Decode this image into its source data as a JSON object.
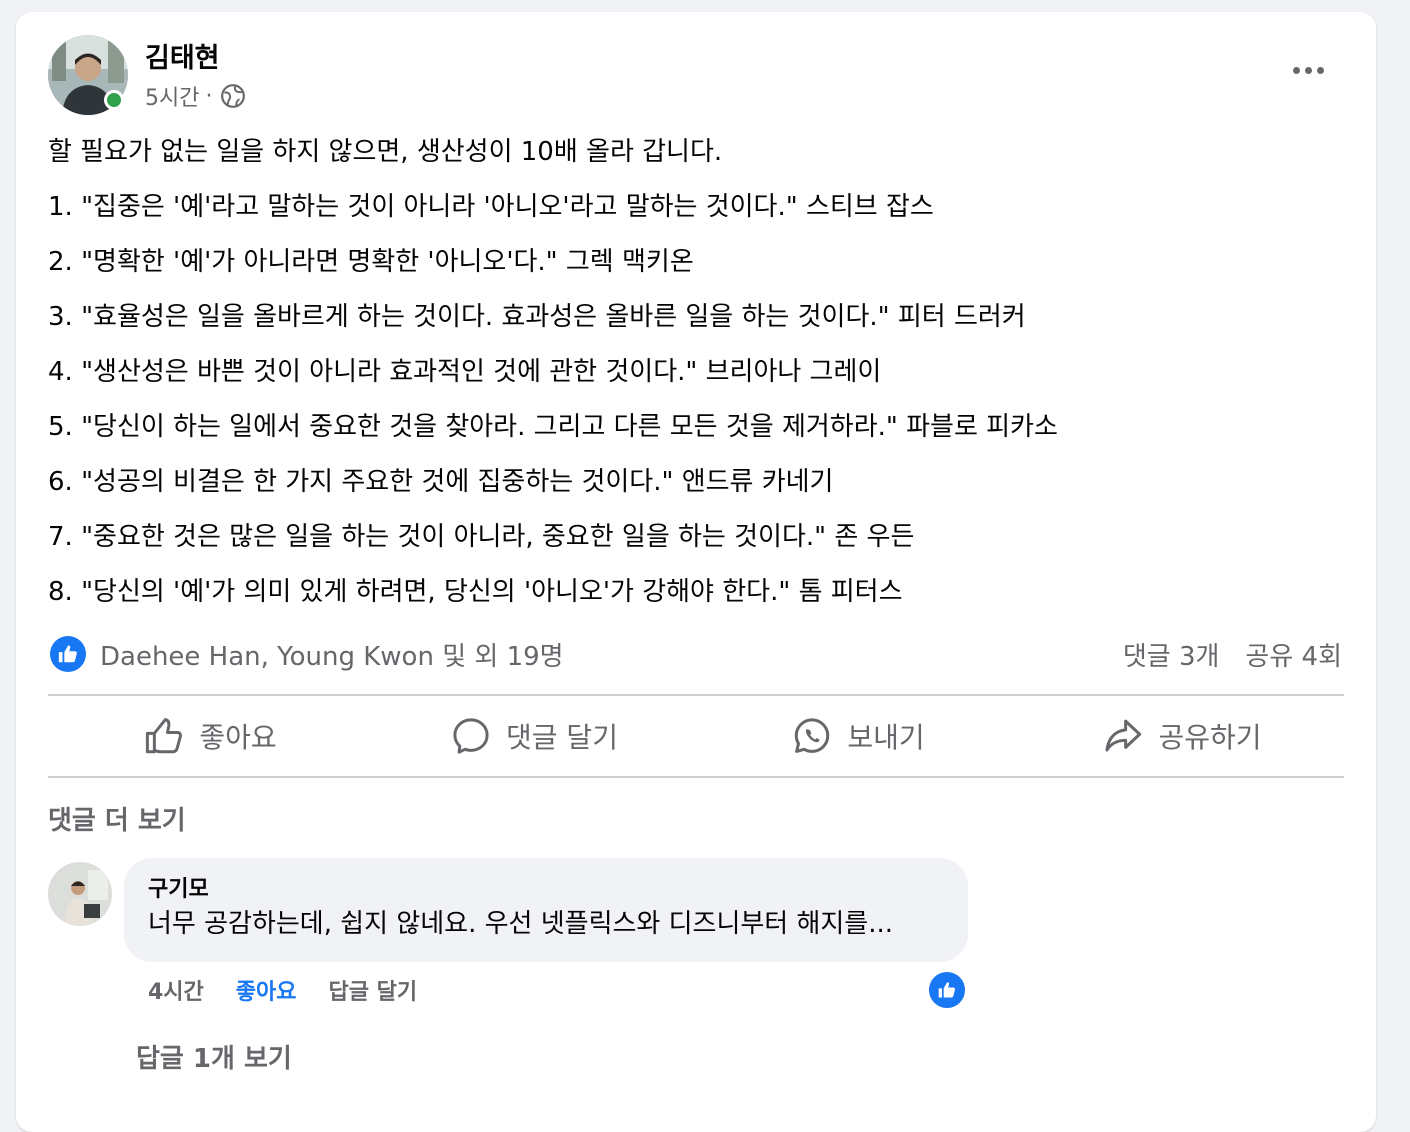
{
  "post": {
    "author": "김태현",
    "time": "5시간",
    "separator": "·",
    "privacy_icon": "globe-icon",
    "lines": [
      "할 필요가 없는 일을 하지 않으면, 생산성이 10배 올라 갑니다.",
      "1. \"집중은 '예'라고 말하는 것이 아니라 '아니오'라고 말하는 것이다.\" 스티브 잡스",
      "2. \"명확한 '예'가 아니라면 명확한 '아니오'다.\" 그렉 맥키온",
      "3. \"효율성은 일을 올바르게 하는 것이다. 효과성은 올바른 일을 하는 것이다.\" 피터 드러커",
      "4. \"생산성은 바쁜 것이 아니라 효과적인 것에 관한 것이다.\" 브리아나 그레이",
      "5. \"당신이 하는 일에서 중요한 것을 찾아라. 그리고 다른 모든 것을 제거하라.\" 파블로 피카소",
      "6. \"성공의 비결은 한 가지 주요한 것에 집중하는 것이다.\" 앤드류 카네기",
      "7. \"중요한 것은 많은 일을 하는 것이 아니라, 중요한 일을 하는 것이다.\" 존 우든",
      "8. \"당신의 '예'가 의미 있게 하려면, 당신의 '아니오'가 강해야 한다.\" 톰 피터스"
    ]
  },
  "reactions": {
    "summary": "Daehee Han, Young Kwon 및 외 19명",
    "comments_count": "댓글 3개",
    "shares_count": "공유 4회"
  },
  "actions": {
    "like": "좋아요",
    "comment": "댓글 달기",
    "send": "보내기",
    "share": "공유하기"
  },
  "comments_section": {
    "more_label": "댓글 더 보기",
    "comment": {
      "author": "구기모",
      "text": "너무 공감하는데, 쉽지 않네요. 우선 넷플릭스와 디즈니부터 해지를...",
      "time": "4시간",
      "like_label": "좋아요",
      "reply_label": "답글 달기"
    },
    "view_replies": "답글 1개 보기"
  },
  "colors": {
    "accent": "#1877f2",
    "online": "#31a24c",
    "secondary_text": "#65676b"
  }
}
